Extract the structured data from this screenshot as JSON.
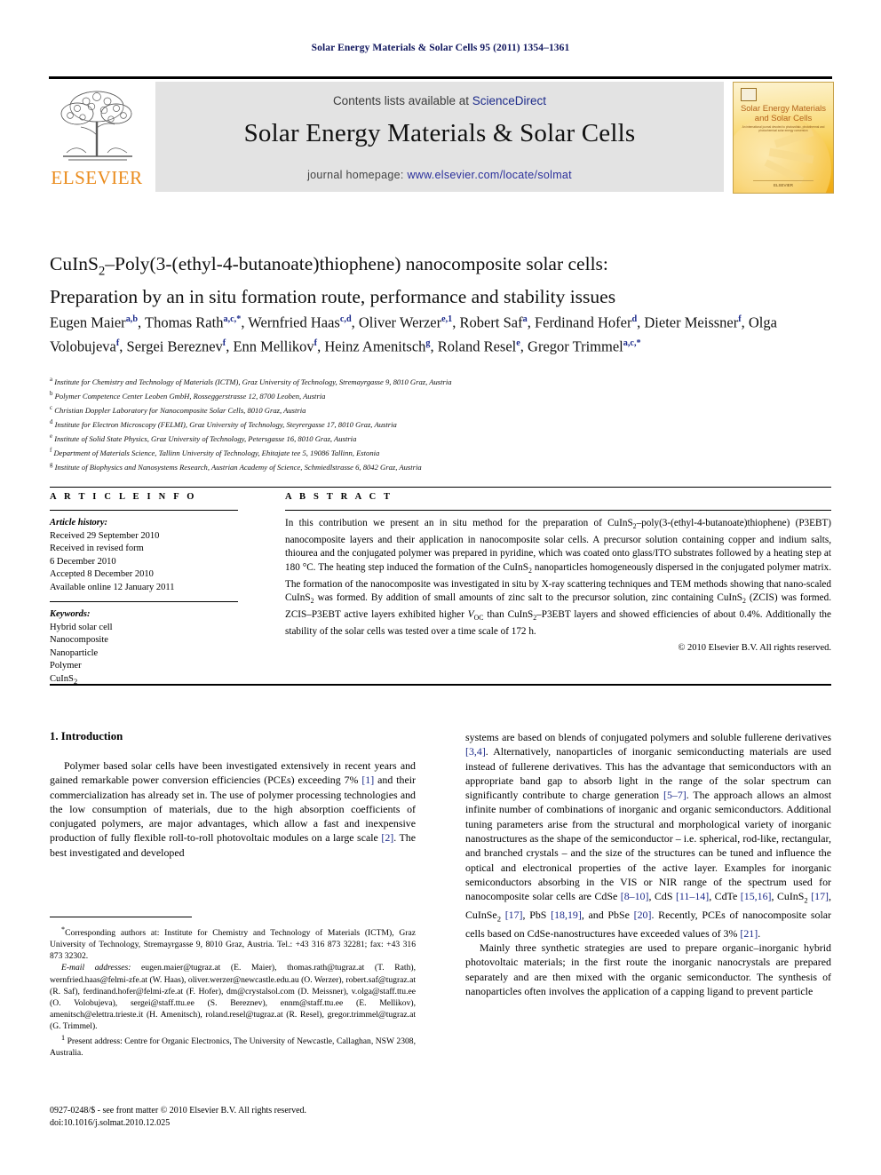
{
  "running_head": "Solar Energy Materials & Solar Cells 95 (2011) 1354–1361",
  "masthead": {
    "contents_prefix": "Contents lists available at ",
    "sciencedirect": "ScienceDirect",
    "journal_title": "Solar Energy Materials & Solar Cells",
    "homepage_prefix": "journal homepage: ",
    "homepage_url": "www.elsevier.com/locate/solmat",
    "publisher": "ELSEVIER",
    "cover": {
      "title_line1": "Solar Energy Materials",
      "title_line2": "and Solar Cells",
      "subtitle": "An international journal devoted to photovoltaic, photothermal and photochemical solar energy conversion",
      "footer": "ELSEVIER"
    },
    "colors": {
      "link": "#1d2b8a",
      "elsevier_orange": "#ea8b1c",
      "band_grey": "#e3e3e3",
      "running_head_navy": "#11175e"
    }
  },
  "article": {
    "title_line1_pre": "CuInS",
    "title_line1_sub": "2",
    "title_line1_post": "–Poly(3-(ethyl-4-butanoate)thiophene) nanocomposite solar cells:",
    "title_line2": "Preparation by an in situ formation route, performance and stability issues",
    "authors": [
      {
        "name": "Eugen Maier",
        "sup": "a,b",
        "sep": ", "
      },
      {
        "name": "Thomas Rath",
        "sup": "a,c,*",
        "sep": ", "
      },
      {
        "name": "Wernfried Haas",
        "sup": "c,d",
        "sep": ", "
      },
      {
        "name": "Oliver Werzer",
        "sup": "e,1",
        "sep": ", "
      },
      {
        "name": "Robert Saf",
        "sup": "a",
        "sep": ", "
      },
      {
        "name": "Ferdinand Hofer",
        "sup": "d",
        "sep": ", "
      },
      {
        "name": "Dieter Meissner",
        "sup": "f",
        "sep": ", "
      },
      {
        "name": "Olga Volobujeva",
        "sup": "f",
        "sep": ", "
      },
      {
        "name": "Sergei Bereznev",
        "sup": "f",
        "sep": ", "
      },
      {
        "name": "Enn Mellikov",
        "sup": "f",
        "sep": ", "
      },
      {
        "name": "Heinz Amenitsch",
        "sup": "g",
        "sep": ", "
      },
      {
        "name": "Roland Resel",
        "sup": "e",
        "sep": ", "
      },
      {
        "name": "Gregor Trimmel",
        "sup": "a,c,*",
        "sep": ""
      }
    ],
    "affiliations": [
      {
        "marker": "a",
        "text": "Institute for Chemistry and Technology of Materials (ICTM), Graz University of Technology, Stremayrgasse 9, 8010 Graz, Austria"
      },
      {
        "marker": "b",
        "text": "Polymer Competence Center Leoben GmbH, Rosseggerstrasse 12, 8700 Leoben, Austria"
      },
      {
        "marker": "c",
        "text": "Christian Doppler Laboratory for Nanocomposite Solar Cells, 8010 Graz, Austria"
      },
      {
        "marker": "d",
        "text": "Institute for Electron Microscopy (FELMI), Graz University of Technology, Steyrergasse 17, 8010 Graz, Austria"
      },
      {
        "marker": "e",
        "text": "Institute of Solid State Physics, Graz University of Technology, Petersgasse 16, 8010 Graz, Austria"
      },
      {
        "marker": "f",
        "text": "Department of Materials Science, Tallinn University of Technology, Ehitajate tee 5, 19086 Tallinn, Estonia"
      },
      {
        "marker": "g",
        "text": "Institute of Biophysics and Nanosystems Research, Austrian Academy of Science, Schmiedlstrasse 6, 8042 Graz, Austria"
      }
    ]
  },
  "article_info": {
    "heading": "A R T I C L E   I N F O",
    "history_label": "Article history:",
    "history_lines": [
      "Received 29 September 2010",
      "Received in revised form",
      "6 December 2010",
      "Accepted 8 December 2010",
      "Available online 12 January 2011"
    ],
    "keywords_label": "Keywords:",
    "keywords": [
      "Hybrid solar cell",
      "Nanocomposite",
      "Nanoparticle",
      "Polymer",
      "CuInS2"
    ]
  },
  "abstract": {
    "heading": "A B S T R A C T",
    "body_html": "In this contribution we present an in situ method for the preparation of CuInS<sub>2</sub>–poly(3-(ethyl-4-butanoate)thiophene) (P3EBT) nanocomposite layers and their application in nanocomposite solar cells. A precursor solution containing copper and indium salts, thiourea and the conjugated polymer was prepared in pyridine, which was coated onto glass/ITO substrates followed by a heating step at 180 °C. The heating step induced the formation of the CuInS<sub>2</sub> nanoparticles homogeneously dispersed in the conjugated polymer matrix. The formation of the nanocomposite was investigated in situ by X-ray scattering techniques and TEM methods showing that nano-scaled CuInS<sub>2</sub> was formed. By addition of small amounts of zinc salt to the precursor solution, zinc containing CuInS<sub>2</sub> (ZCIS) was formed. ZCIS–P3EBT active layers exhibited higher <i>V</i><sub>OC</sub> than CuInS<sub>2</sub>–P3EBT layers and showed efficiencies of about 0.4%. Additionally the stability of the solar cells was tested over a time scale of 172 h.",
    "copyright": "© 2010 Elsevier B.V. All rights reserved."
  },
  "body": {
    "section_number_title": "1.  Introduction",
    "left_paragraph_html": "Polymer based solar cells have been investigated extensively in recent years and gained remarkable power conversion efficiencies (PCEs) exceeding 7% <span class=\"ref\">[1]</span> and their commercialization has already set in. The use of polymer processing technologies and the low consumption of materials, due to the high absorption coefficients of conjugated polymers, are major advantages, which allow a fast and inexpensive production of fully flexible roll-to-roll photovoltaic modules on a large scale <span class=\"ref\">[2]</span>. The best investigated and developed",
    "right_paragraph1_html": "systems are based on blends of conjugated polymers and soluble fullerene derivatives <span class=\"ref\">[3,4]</span>. Alternatively, nanoparticles of inorganic semiconducting materials are used instead of fullerene derivatives. This has the advantage that semiconductors with an appropriate band gap to absorb light in the range of the solar spectrum can significantly contribute to charge generation <span class=\"ref\">[5–7]</span>. The approach allows an almost infinite number of combinations of inorganic and organic semiconductors. Additional tuning parameters arise from the structural and morphological variety of inorganic nanostructures as the shape of the semiconductor – i.e. spherical, rod-like, rectangular, and branched crystals – and the size of the structures can be tuned and influence the optical and electronical properties of the active layer. Examples for inorganic semiconductors absorbing in the VIS or NIR range of the spectrum used for nanocomposite solar cells are CdSe <span class=\"ref\">[8–10]</span>, CdS <span class=\"ref\">[11–14]</span>, CdTe <span class=\"ref\">[15,16]</span>, CuInS<sub>2</sub> <span class=\"ref\">[17]</span>, CuInSe<sub>2</sub> <span class=\"ref\">[17]</span>, PbS <span class=\"ref\">[18,19]</span>, and PbSe <span class=\"ref\">[20]</span>. Recently, PCEs of nanocomposite solar cells based on CdSe-nanostructures have exceeded values of 3% <span class=\"ref\">[21]</span>.",
    "right_paragraph2_html": "Mainly three synthetic strategies are used to prepare organic–inorganic hybrid photovoltaic materials; in the first route the inorganic nanocrystals are prepared separately and are then mixed with the organic semiconductor. The synthesis of nanoparticles often involves the application of a capping ligand to prevent particle"
  },
  "footnotes": {
    "corresponding_html": "<sup>*</sup>Corresponding authors at: Institute for Chemistry and Technology of Materials (ICTM), Graz University of Technology, Stremayrgasse 9, 8010 Graz, Austria. Tel.: +43 316 873 32281; fax: +43 316 873 32302.",
    "emails_html": "<i>E-mail addresses:</i> eugen.maier@tugraz.at (E. Maier), thomas.rath@tugraz.at (T. Rath), wernfried.haas@felmi-zfe.at (W. Haas), oliver.werzer@newcastle.edu.au (O. Werzer), robert.saf@tugraz.at (R. Saf), ferdinand.hofer@felmi-zfe.at (F. Hofer), dm@crystalsol.com (D. Meissner), v.olga@staff.ttu.ee (O. Volobujeva), sergei@staff.ttu.ee (S. Bereznev), ennm@staff.ttu.ee (E. Mellikov), amenitsch@elettra.trieste.it (H. Amenitsch), roland.resel@tugraz.at (R. Resel), gregor.trimmel@tugraz.at (G. Trimmel).",
    "present_address_html": "<sup>1</sup> Present address: Centre for Organic Electronics, The University of Newcastle, Callaghan, NSW 2308, Australia."
  },
  "imprint": {
    "issn_line": "0927-0248/$ - see front matter © 2010 Elsevier B.V. All rights reserved.",
    "doi_line": "doi:10.1016/j.solmat.2010.12.025"
  }
}
